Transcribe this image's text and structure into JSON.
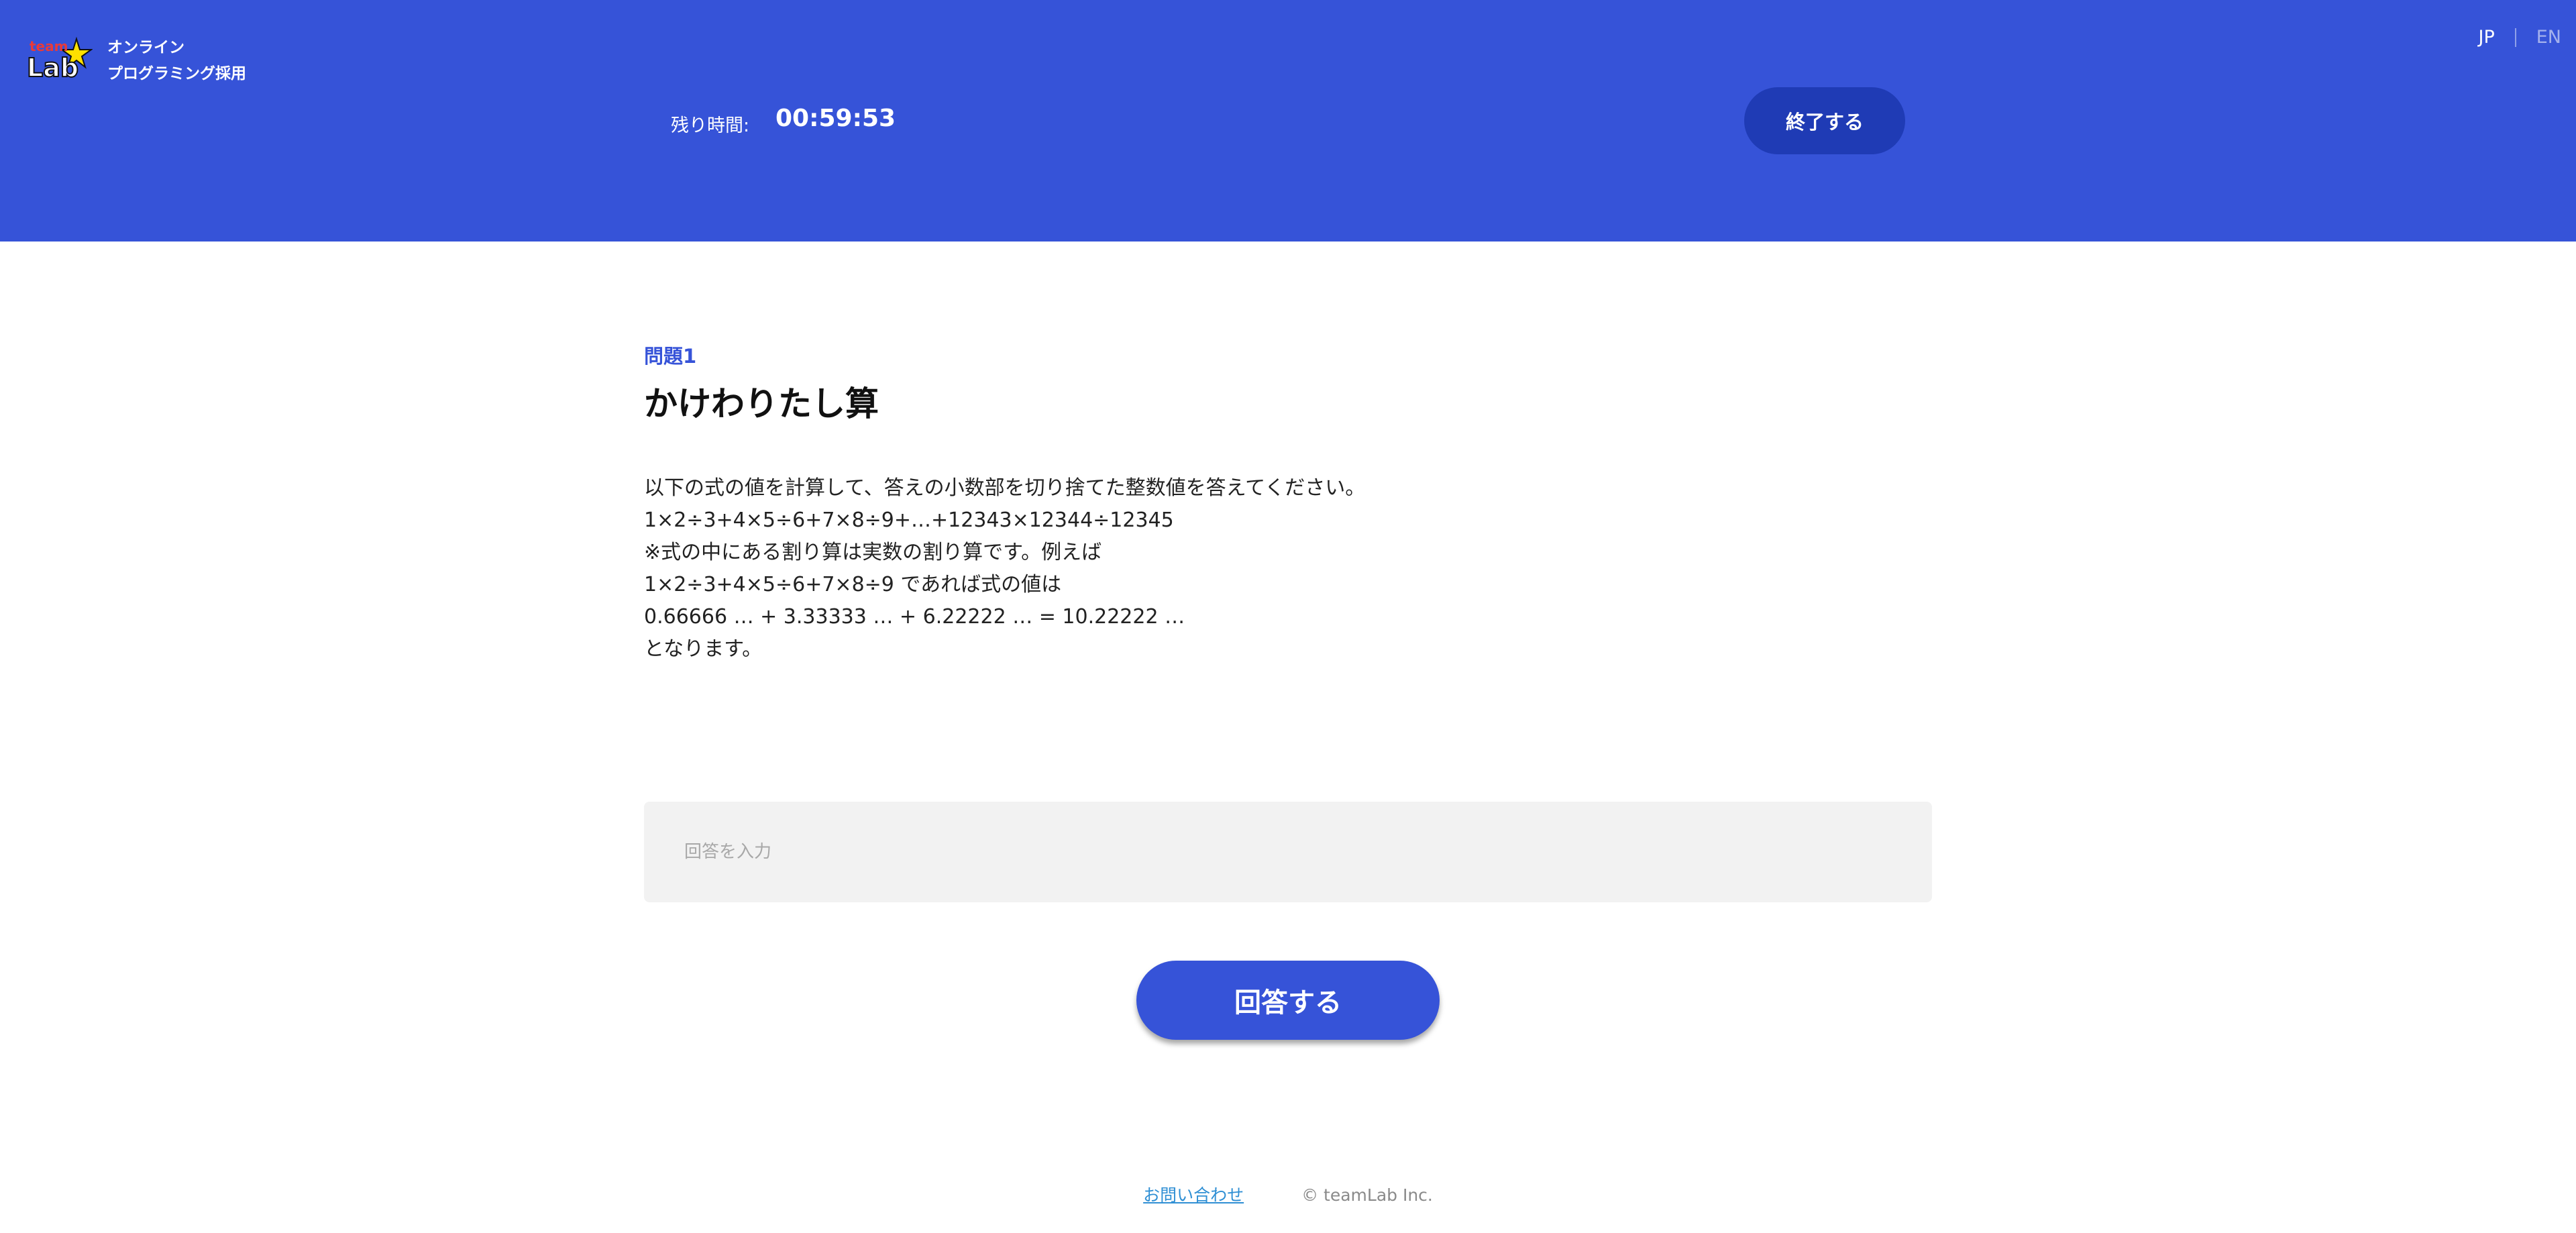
{
  "header": {
    "logo_text": "team Lab",
    "brand_line1": "オンライン",
    "brand_line2": "プログラミング採用",
    "lang_jp": "JP",
    "lang_en": "EN",
    "timer_label": "残り時間:",
    "timer_value": "00:59:53",
    "end_button_label": "終了する"
  },
  "problem": {
    "number": "問題1",
    "title": "かけわりたし算",
    "lines": [
      "以下の式の値を計算して、答えの小数部を切り捨てた整数値を答えてください。",
      "1×2÷3+4×5÷6+7×8÷9+…+12343×12344÷12345",
      "※式の中にある割り算は実数の割り算です。例えば",
      "1×2÷3+4×5÷6+7×8÷9 であれば式の値は",
      "0.66666 … + 3.33333 … + 6.22222 … = 10.22222 …",
      "となります。"
    ]
  },
  "answer": {
    "placeholder": "回答を入力",
    "value": ""
  },
  "submit_label": "回答する",
  "footer": {
    "contact": "お問い合わせ",
    "copyright": "© teamLab Inc."
  },
  "colors": {
    "header_bg": "#3653d8",
    "end_button_bg": "#1f3bb5",
    "accent": "#3653d8",
    "link": "#2f8fd4"
  },
  "icons": {
    "logo": "teamlab-star-logo"
  }
}
